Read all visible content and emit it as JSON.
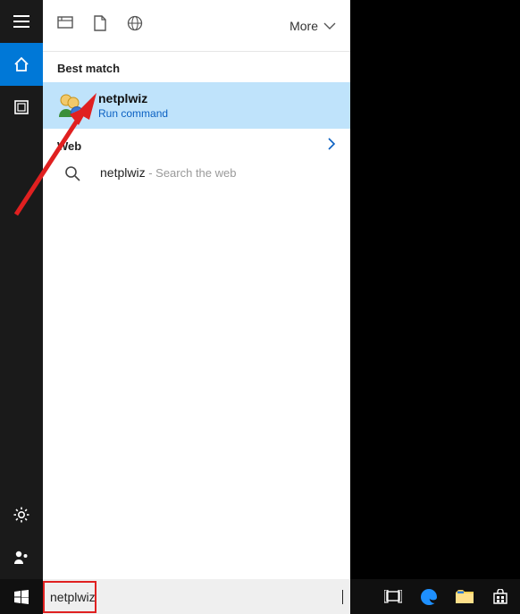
{
  "rail": {
    "items": [
      "menu",
      "home",
      "apps"
    ],
    "bottom": [
      "settings",
      "account"
    ]
  },
  "toolbar": {
    "more_label": "More"
  },
  "sections": {
    "best_match_label": "Best match",
    "web_label": "Web"
  },
  "best_match": {
    "title": "netplwiz",
    "subtitle": "Run command"
  },
  "web": {
    "item_title": "netplwiz",
    "item_suffix": " - Search the web"
  },
  "search": {
    "value": "netplwiz",
    "placeholder": ""
  }
}
